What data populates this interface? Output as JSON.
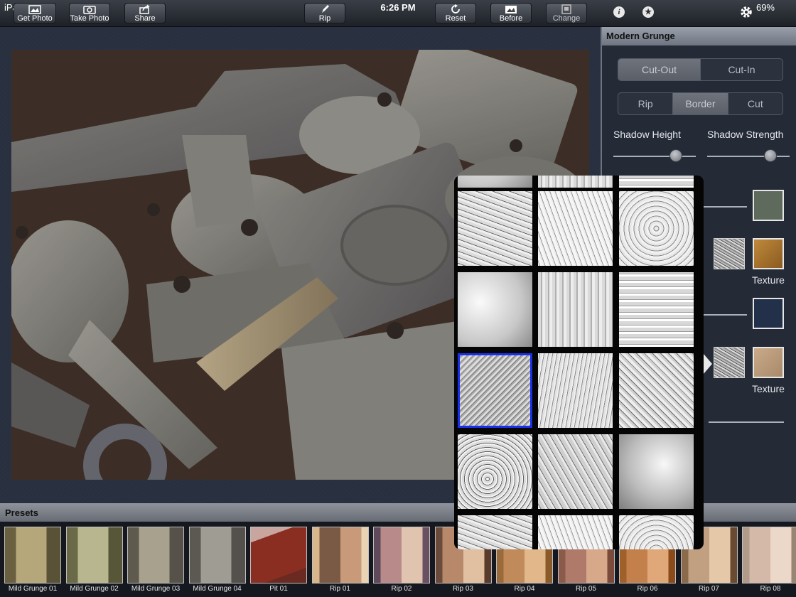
{
  "status": {
    "carrier": "iPad",
    "time": "6:26 PM",
    "battery": "69%"
  },
  "toolbar": {
    "get_photo": "Get Photo",
    "take_photo": "Take Photo",
    "share": "Share",
    "rip": "Rip",
    "reset": "Reset",
    "before": "Before",
    "change": "Change"
  },
  "panel": {
    "title": "Modern Grunge",
    "mode_tabs": [
      {
        "label": "Cut-Out",
        "selected": true
      },
      {
        "label": "Cut-In",
        "selected": false
      }
    ],
    "type_tabs": [
      {
        "label": "Rip",
        "selected": false
      },
      {
        "label": "Border",
        "selected": true
      },
      {
        "label": "Cut",
        "selected": false
      }
    ],
    "shadow_height_label": "Shadow Height",
    "shadow_strength_label": "Shadow Strength",
    "shadow_height_value": 0.76,
    "shadow_strength_value": 0.77,
    "texture_label_1": "Texture",
    "texture_label_2": "Texture",
    "swatch_colors": [
      "#5d6a5c",
      "#22304a"
    ],
    "texture_swatch_colors": [
      "#c08a3c",
      "#c9ab8a"
    ]
  },
  "texture_picker": {
    "selected_index": 6
  },
  "presets": {
    "title": "Presets",
    "items": [
      {
        "label": "Mild Grunge 01"
      },
      {
        "label": "Mild Grunge 02"
      },
      {
        "label": "Mild Grunge 03"
      },
      {
        "label": "Mild Grunge 04"
      },
      {
        "label": "Pit 01"
      },
      {
        "label": "Rip 01"
      },
      {
        "label": "Rip 02"
      },
      {
        "label": "Rip 03"
      },
      {
        "label": "Rip 04"
      },
      {
        "label": "Rip 05"
      },
      {
        "label": "Rip 06"
      },
      {
        "label": "Rip 07"
      },
      {
        "label": "Rip 08"
      }
    ]
  }
}
